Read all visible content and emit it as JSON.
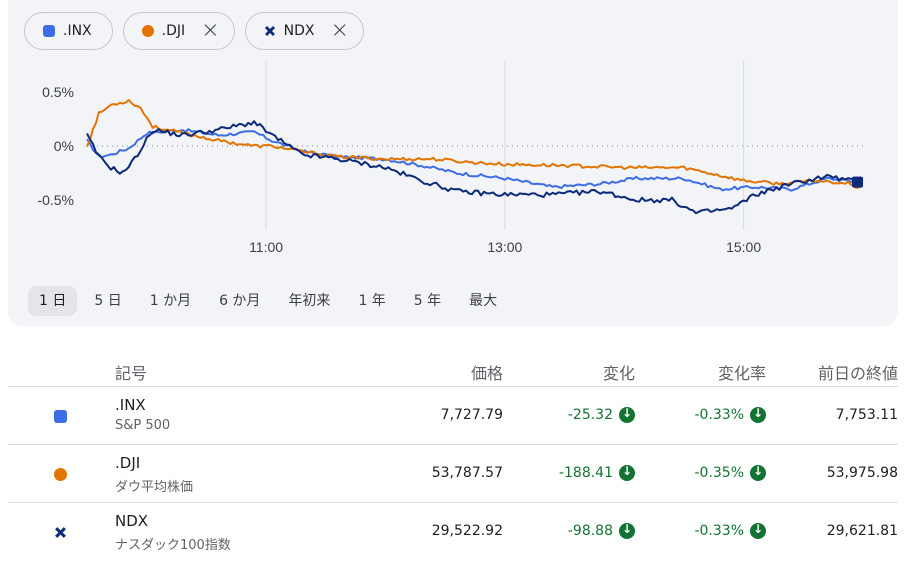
{
  "chips": [
    {
      "label": ".INX",
      "color": "#3d6ee6",
      "marker": "square",
      "closable": false
    },
    {
      "label": ".DJI",
      "color": "#e37400",
      "marker": "circle",
      "closable": true
    },
    {
      "label": "NDX",
      "color": "#0b2b7a",
      "marker": "cross",
      "closable": true
    }
  ],
  "close_icon": "×",
  "chart_data": {
    "type": "line",
    "y_ticks": [
      "0.5%",
      "0%",
      "-0.5%"
    ],
    "x_ticks": [
      "11:00",
      "13:00",
      "15:00"
    ],
    "x_range": [
      "09:30",
      "16:00"
    ],
    "ylim": [
      -0.85,
      0.7
    ],
    "zero_baseline": "dotted",
    "series": [
      {
        "name": ".INX",
        "color": "#3d6ee6",
        "points": [
          [
            9.5,
            0.05
          ],
          [
            9.6,
            -0.1
          ],
          [
            9.7,
            -0.08
          ],
          [
            9.85,
            -0.02
          ],
          [
            10.0,
            0.12
          ],
          [
            10.3,
            0.15
          ],
          [
            10.6,
            0.1
          ],
          [
            10.9,
            0.13
          ],
          [
            11.05,
            0.05
          ],
          [
            11.3,
            -0.05
          ],
          [
            11.6,
            -0.1
          ],
          [
            12.0,
            -0.12
          ],
          [
            12.3,
            -0.18
          ],
          [
            12.6,
            -0.25
          ],
          [
            13.0,
            -0.3
          ],
          [
            13.4,
            -0.38
          ],
          [
            13.8,
            -0.35
          ],
          [
            14.1,
            -0.3
          ],
          [
            14.5,
            -0.3
          ],
          [
            14.8,
            -0.4
          ],
          [
            15.1,
            -0.38
          ],
          [
            15.4,
            -0.4
          ],
          [
            15.7,
            -0.3
          ],
          [
            15.95,
            -0.33
          ]
        ]
      },
      {
        "name": ".DJI",
        "color": "#e37400",
        "points": [
          [
            9.5,
            0.0
          ],
          [
            9.6,
            0.3
          ],
          [
            9.7,
            0.38
          ],
          [
            9.85,
            0.42
          ],
          [
            9.95,
            0.35
          ],
          [
            10.05,
            0.18
          ],
          [
            10.3,
            0.12
          ],
          [
            10.6,
            0.05
          ],
          [
            10.9,
            0.0
          ],
          [
            11.05,
            0.0
          ],
          [
            11.3,
            -0.05
          ],
          [
            11.6,
            -0.1
          ],
          [
            12.0,
            -0.12
          ],
          [
            12.4,
            -0.12
          ],
          [
            12.7,
            -0.15
          ],
          [
            13.0,
            -0.17
          ],
          [
            13.5,
            -0.18
          ],
          [
            14.0,
            -0.2
          ],
          [
            14.5,
            -0.2
          ],
          [
            15.0,
            -0.32
          ],
          [
            15.3,
            -0.35
          ],
          [
            15.6,
            -0.32
          ],
          [
            15.95,
            -0.35
          ]
        ]
      },
      {
        "name": "NDX",
        "color": "#0b2b7a",
        "points": [
          [
            9.5,
            0.1
          ],
          [
            9.6,
            -0.1
          ],
          [
            9.7,
            -0.2
          ],
          [
            9.8,
            -0.25
          ],
          [
            9.9,
            -0.12
          ],
          [
            10.05,
            0.15
          ],
          [
            10.3,
            0.1
          ],
          [
            10.6,
            0.15
          ],
          [
            10.9,
            0.22
          ],
          [
            11.05,
            0.1
          ],
          [
            11.3,
            -0.08
          ],
          [
            11.6,
            -0.12
          ],
          [
            12.0,
            -0.2
          ],
          [
            12.3,
            -0.32
          ],
          [
            12.6,
            -0.42
          ],
          [
            13.0,
            -0.45
          ],
          [
            13.4,
            -0.45
          ],
          [
            13.8,
            -0.42
          ],
          [
            14.1,
            -0.5
          ],
          [
            14.4,
            -0.5
          ],
          [
            14.6,
            -0.62
          ],
          [
            14.9,
            -0.58
          ],
          [
            15.1,
            -0.45
          ],
          [
            15.4,
            -0.35
          ],
          [
            15.7,
            -0.28
          ],
          [
            15.95,
            -0.33
          ]
        ]
      }
    ]
  },
  "periods": [
    {
      "label": "1 日",
      "active": true
    },
    {
      "label": "5 日",
      "active": false
    },
    {
      "label": "1 か月",
      "active": false
    },
    {
      "label": "6 か月",
      "active": false
    },
    {
      "label": "年初来",
      "active": false
    },
    {
      "label": "1 年",
      "active": false
    },
    {
      "label": "5 年",
      "active": false
    },
    {
      "label": "最大",
      "active": false
    }
  ],
  "table": {
    "headers": {
      "symbol": "記号",
      "price": "価格",
      "change": "変化",
      "change_pct": "変化率",
      "prev_close": "前日の終値"
    },
    "rows": [
      {
        "symbol": ".INX",
        "name": "S&P 500",
        "price": "7,727.79",
        "change": "-25.32",
        "change_pct": "-0.33%",
        "prev_close": "7,753.11",
        "color": "#3d6ee6",
        "marker": "square"
      },
      {
        "symbol": ".DJI",
        "name": "ダウ平均株価",
        "price": "53,787.57",
        "change": "-188.41",
        "change_pct": "-0.35%",
        "prev_close": "53,975.98",
        "color": "#e37400",
        "marker": "circle"
      },
      {
        "symbol": "NDX",
        "name": "ナスダック100指数",
        "price": "29,522.92",
        "change": "-98.88",
        "change_pct": "-0.33%",
        "prev_close": "29,621.81",
        "color": "#0b2b7a",
        "marker": "cross"
      }
    ]
  }
}
